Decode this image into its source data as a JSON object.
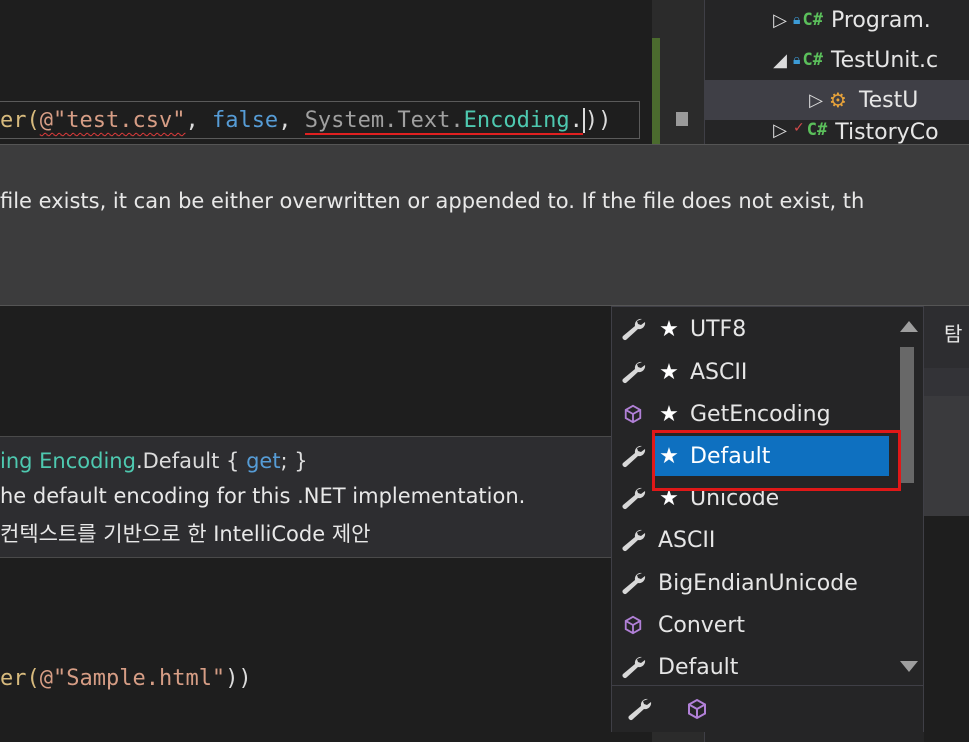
{
  "solution_explorer": {
    "items": [
      {
        "label": "Program.",
        "badge": "C#",
        "expanded": false
      },
      {
        "label": "TestUnit.c",
        "badge": "C#",
        "expanded": true
      },
      {
        "label": "TestU",
        "badge": "",
        "expanded": false
      },
      {
        "label": "TistoryCo",
        "badge": "C#",
        "expanded": false
      }
    ]
  },
  "editor": {
    "line1": {
      "prefix": "er(",
      "at_str": "@\"test.csv\"",
      "comma1": ", ",
      "kw_false": "false",
      "comma2": ", ",
      "ns": "System.Text.",
      "type": "Encoding",
      "dot": ".",
      "close": "))"
    },
    "line2": {
      "prefix": "er(",
      "at_str": "@\"Sample.html\"",
      "close": "))"
    }
  },
  "signature_tooltip": {
    "text": "file exists, it can be either overwritten or appended to. If the file does not exist, th"
  },
  "quick_info": {
    "kw_prefix": "ing ",
    "type": "Encoding",
    "member": ".Default { ",
    "get": "get",
    "end": "; }",
    "description": "he default encoding for this .NET implementation.",
    "intellicode": " 컨텍스트를 기반으로 한 IntelliCode 제안"
  },
  "completion": {
    "items": [
      {
        "label": "UTF8",
        "starred": true,
        "icon": "wrench-icon"
      },
      {
        "label": "ASCII",
        "starred": true,
        "icon": "wrench-icon"
      },
      {
        "label": "GetEncoding",
        "starred": true,
        "icon": "cube-icon"
      },
      {
        "label": "Default",
        "starred": true,
        "icon": "wrench-icon",
        "selected": true
      },
      {
        "label": "Unicode",
        "starred": true,
        "icon": "wrench-icon"
      },
      {
        "label": "ASCII",
        "starred": false,
        "icon": "wrench-icon"
      },
      {
        "label": "BigEndianUnicode",
        "starred": false,
        "icon": "wrench-icon"
      },
      {
        "label": "Convert",
        "starred": false,
        "icon": "cube-icon"
      },
      {
        "label": "Default",
        "starred": false,
        "icon": "wrench-icon"
      }
    ],
    "star_glyph": "★"
  },
  "right_panel": {
    "text": "탐"
  },
  "colors": {
    "selection": "#0e70c0",
    "highlight_box": "#e01818",
    "keyword": "#569cd6",
    "string": "#d69d85",
    "type": "#4ec9b0"
  }
}
